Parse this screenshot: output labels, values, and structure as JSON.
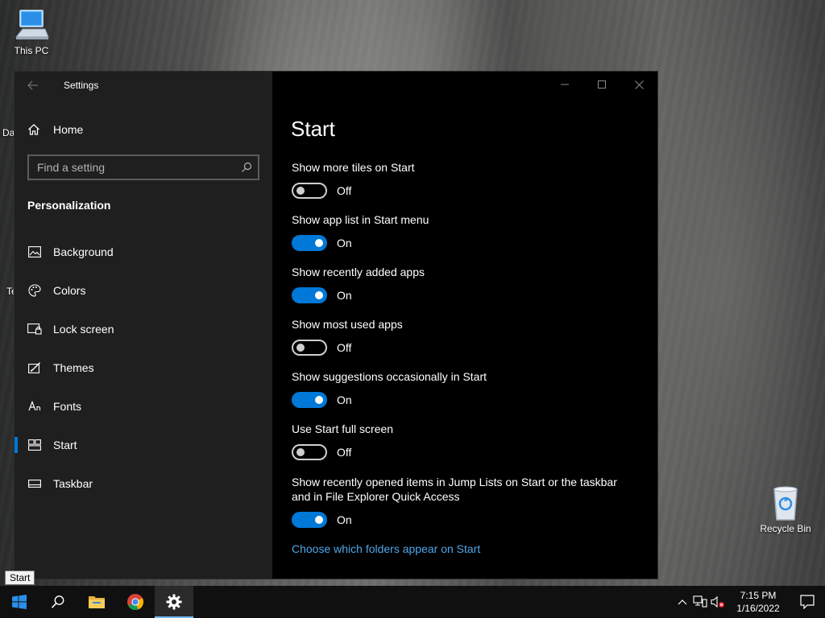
{
  "desktop": {
    "this_pc_label": "This PC",
    "recycle_bin_label": "Recycle Bin",
    "fragment_1": "Da",
    "fragment_2": "Te"
  },
  "window": {
    "title": "Settings"
  },
  "sidebar": {
    "home_label": "Home",
    "search_placeholder": "Find a setting",
    "section_title": "Personalization",
    "items": [
      {
        "label": "Background",
        "icon": "image-icon"
      },
      {
        "label": "Colors",
        "icon": "palette-icon"
      },
      {
        "label": "Lock screen",
        "icon": "lock-screen-icon"
      },
      {
        "label": "Themes",
        "icon": "themes-icon"
      },
      {
        "label": "Fonts",
        "icon": "fonts-icon"
      },
      {
        "label": "Start",
        "icon": "start-layout-icon",
        "active": true
      },
      {
        "label": "Taskbar",
        "icon": "taskbar-icon"
      }
    ]
  },
  "content": {
    "page_title": "Start",
    "settings": [
      {
        "label": "Show more tiles on Start",
        "state": "Off"
      },
      {
        "label": "Show app list in Start menu",
        "state": "On"
      },
      {
        "label": "Show recently added apps",
        "state": "On"
      },
      {
        "label": "Show most used apps",
        "state": "Off"
      },
      {
        "label": "Show suggestions occasionally in Start",
        "state": "On"
      },
      {
        "label": "Use Start full screen",
        "state": "Off"
      },
      {
        "label_line1": "Show recently opened items in Jump Lists on Start or the taskbar",
        "label_line2": "and in File Explorer Quick Access",
        "state": "On"
      }
    ],
    "link_text": "Choose which folders appear on Start"
  },
  "tooltip": "Start",
  "taskbar": {
    "time": "7:15 PM",
    "date": "1/16/2022"
  },
  "colors": {
    "accent": "#0078d7",
    "link": "#4ea6ea",
    "sidebar_bg": "#1f1f1f",
    "content_bg": "#000000"
  }
}
